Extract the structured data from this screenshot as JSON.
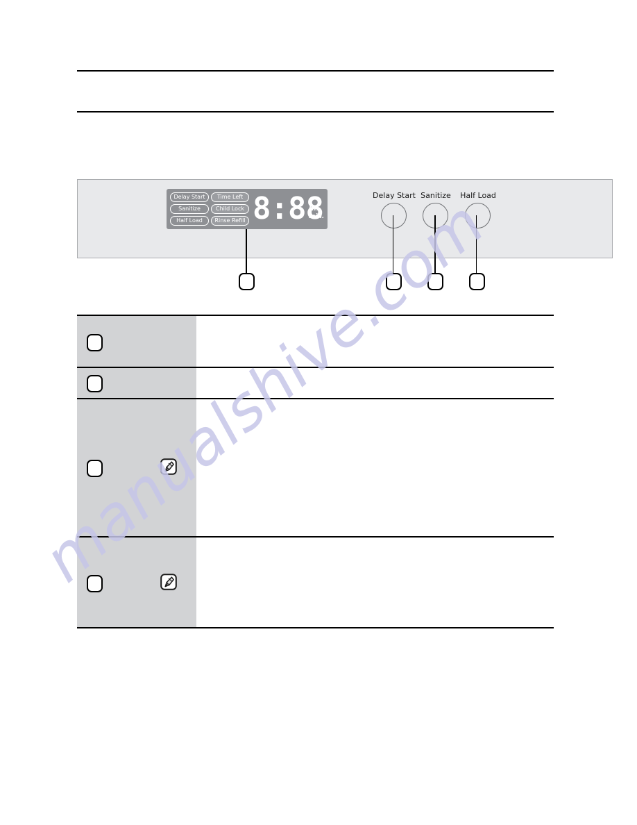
{
  "page": {
    "watermark_text": "manualshive.com",
    "watermark_color": "#c6c6e8",
    "background_color": "#ffffff"
  },
  "control_panel": {
    "name": "dishwasher-control-panel-illustration",
    "panel_color": "#e8e9eb",
    "panel_border_color": "#a9abae",
    "display": {
      "module_color": "#8e9094",
      "indicators": [
        {
          "left_label": "Delay Start",
          "right_label": "Time Left"
        },
        {
          "left_label": "Sanitize",
          "right_label": "Child Lock"
        },
        {
          "left_label": "Half Load",
          "right_label": "Rinse Refill"
        }
      ],
      "segment_value": "8:88",
      "unit_line_1": "Hr.",
      "unit_line_2": "min."
    },
    "buttons": [
      {
        "label": "Delay Start",
        "icon": "round-button-icon"
      },
      {
        "label": "Sanitize",
        "icon": "round-button-icon"
      },
      {
        "label": "Half Load",
        "icon": "round-button-icon"
      }
    ]
  },
  "callouts": [
    {
      "id": "callout-1",
      "label": ""
    },
    {
      "id": "callout-2",
      "label": ""
    },
    {
      "id": "callout-3",
      "label": ""
    },
    {
      "id": "callout-4",
      "label": ""
    }
  ],
  "description_table": {
    "index_cell_color": "#d2d3d5",
    "rows": [
      {
        "index_label": "",
        "body_text": "",
        "has_note_icon": false
      },
      {
        "index_label": "",
        "body_text": "",
        "has_note_icon": false
      },
      {
        "index_label": "",
        "body_text": "",
        "has_note_icon": true
      },
      {
        "index_label": "",
        "body_text": "",
        "has_note_icon": true
      }
    ]
  },
  "note_icon": {
    "name": "note-pen-icon",
    "glyph": "note-pen"
  }
}
